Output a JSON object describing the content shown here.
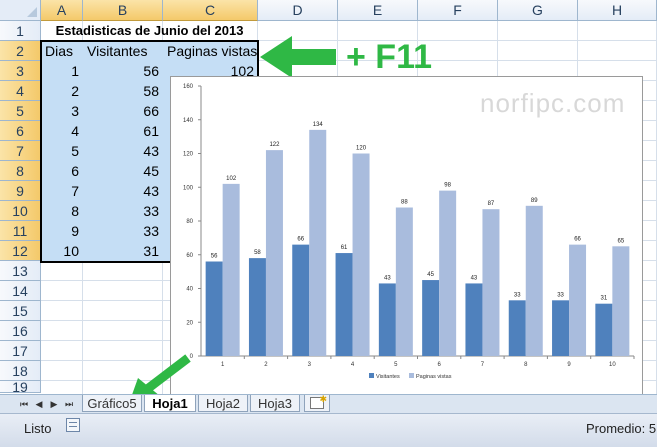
{
  "columns": [
    "A",
    "B",
    "C",
    "D",
    "E",
    "F",
    "G",
    "H"
  ],
  "rows": [
    "1",
    "2",
    "3",
    "4",
    "5",
    "6",
    "7",
    "8",
    "9",
    "10",
    "11",
    "12",
    "13",
    "14",
    "15",
    "16",
    "17",
    "18",
    "19"
  ],
  "title_cell": "Estadisticas de Junio del 2013",
  "headers": [
    "Dias",
    "Visitantes",
    "Paginas vistas"
  ],
  "table": [
    [
      "1",
      "56",
      "102"
    ],
    [
      "2",
      "58",
      "122"
    ],
    [
      "3",
      "66",
      "134"
    ],
    [
      "4",
      "61",
      "120"
    ],
    [
      "5",
      "43",
      "88"
    ],
    [
      "6",
      "45",
      "98"
    ],
    [
      "7",
      "43",
      "87"
    ],
    [
      "8",
      "33",
      "89"
    ],
    [
      "9",
      "33",
      "66"
    ],
    [
      "10",
      "31",
      "65"
    ]
  ],
  "annotation": "+ F11",
  "watermark": "norfipc.com",
  "tabs": [
    "Gráfico5",
    "Hoja1",
    "Hoja2",
    "Hoja3"
  ],
  "status": {
    "mode": "Listo",
    "average": "Promedio: 5"
  },
  "colors": {
    "series1": "#4f81bd",
    "series2": "#a9bcdd",
    "arrow": "#2fb845",
    "selection": "#c5def5"
  },
  "chart_data": {
    "type": "bar",
    "categories": [
      "1",
      "2",
      "3",
      "4",
      "5",
      "6",
      "7",
      "8",
      "9",
      "10"
    ],
    "series": [
      {
        "name": "Visitantes",
        "values": [
          56,
          58,
          66,
          61,
          43,
          45,
          43,
          33,
          33,
          31
        ]
      },
      {
        "name": "Paginas vistas",
        "values": [
          102,
          122,
          134,
          120,
          88,
          98,
          87,
          89,
          66,
          65
        ]
      }
    ],
    "yticks": [
      "0",
      "20",
      "40",
      "60",
      "80",
      "100",
      "120",
      "140",
      "160"
    ],
    "ylim": [
      0,
      160
    ],
    "grid": false,
    "legend": "bottom"
  }
}
